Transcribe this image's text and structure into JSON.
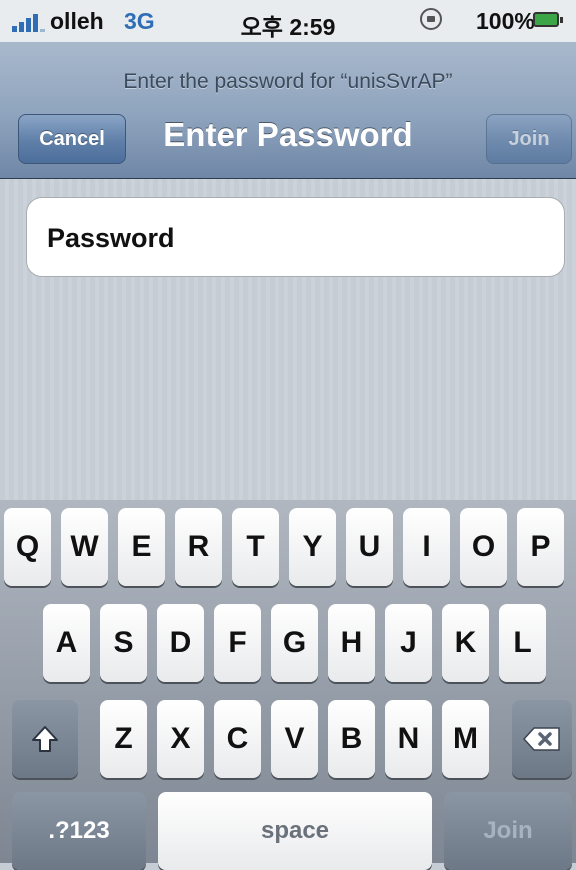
{
  "status_bar": {
    "carrier": "olleh",
    "network": "3G",
    "time": "오후 2:59",
    "battery": "100%",
    "icons": [
      "signal-bars-icon",
      "rotation-lock-icon",
      "battery-charging-icon"
    ]
  },
  "header": {
    "prompt": "Enter the password for “unisSvrAP”",
    "title": "Enter Password",
    "cancel_label": "Cancel",
    "join_label": "Join"
  },
  "form": {
    "password_placeholder": "Password",
    "password_value": ""
  },
  "keyboard": {
    "row1": [
      "Q",
      "W",
      "E",
      "R",
      "T",
      "Y",
      "U",
      "I",
      "O",
      "P"
    ],
    "row2": [
      "A",
      "S",
      "D",
      "F",
      "G",
      "H",
      "J",
      "K",
      "L"
    ],
    "row3": [
      "Z",
      "X",
      "C",
      "V",
      "B",
      "N",
      "M"
    ],
    "shift_icon": "shift-arrow-icon",
    "delete_icon": "backspace-icon",
    "numbers_label": ".?123",
    "space_label": "space",
    "join_label": "Join"
  },
  "colors": {
    "nav_blue": "#6f87a6",
    "status_blue": "#2f6db5",
    "battery_green": "#3ca548"
  }
}
